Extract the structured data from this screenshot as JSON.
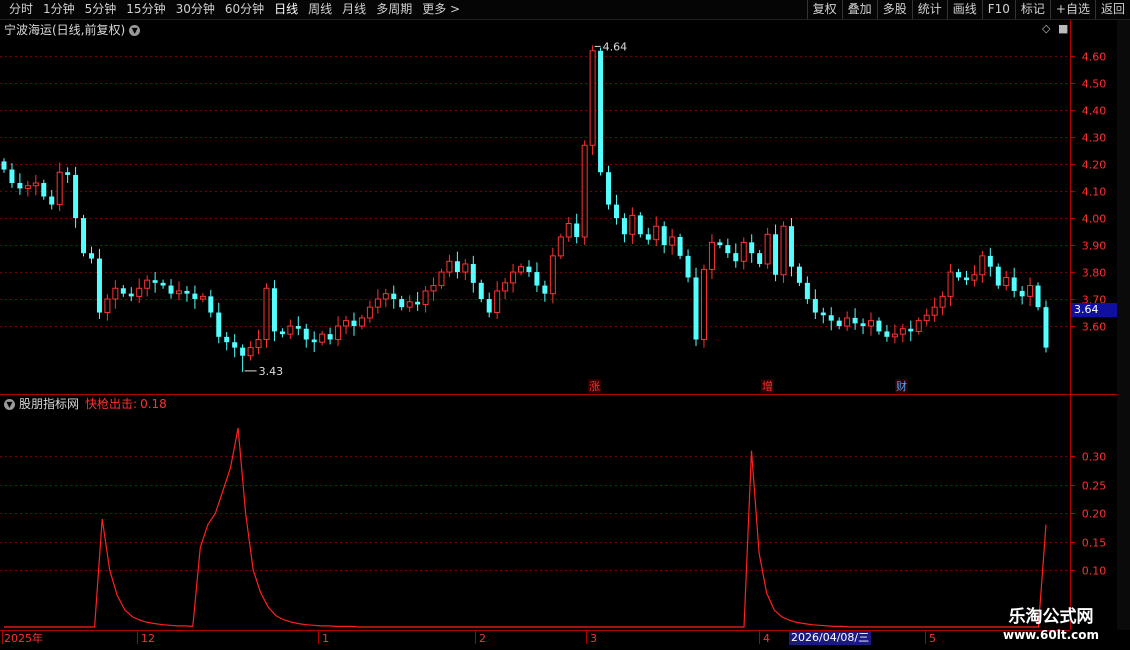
{
  "toolbar": {
    "periods": [
      "分时",
      "1分钟",
      "5分钟",
      "15分钟",
      "30分钟",
      "60分钟",
      "日线",
      "周线",
      "月线",
      "多周期",
      "更多 >"
    ],
    "active_period": "日线",
    "tools": [
      "复权",
      "叠加",
      "多股",
      "统计",
      "画线",
      "F10",
      "标记",
      "+自选",
      "返回"
    ]
  },
  "main_panel": {
    "title": "宁波海运(日线,前复权)",
    "high_label": "4.64",
    "low_label": "3.43",
    "current_price": "3.64",
    "events": [
      {
        "label": "涨",
        "color": "#ff3030"
      },
      {
        "label": "增",
        "color": "#ff3030"
      },
      {
        "label": "财",
        "color": "#4aa8ff"
      }
    ]
  },
  "indicator_panel": {
    "name": "股朋指标网",
    "line_label": "快枪出击:",
    "line_value": "0.18"
  },
  "date_axis": {
    "year_label": "2025年",
    "month_labels": [
      "12",
      "1",
      "2",
      "3",
      "4",
      "5"
    ],
    "cursor_date": "2026/04/08/三"
  },
  "watermark": {
    "title": "乐淘公式网",
    "url": "www.60lt.com"
  },
  "colors": {
    "up": "#ff3232",
    "down": "#54ffff",
    "indicator_line": "#ff2020",
    "grid": "#7a0000"
  },
  "chart_data": [
    {
      "type": "candlestick",
      "title": "宁波海运(日线,前复权)",
      "yticks": [
        3.6,
        3.7,
        3.8,
        3.9,
        4.0,
        4.1,
        4.2,
        4.3,
        4.4,
        4.5,
        4.6
      ],
      "ylim": [
        3.4,
        4.66
      ],
      "max": 4.64,
      "min": 3.43,
      "last": 3.64,
      "closes": [
        4.18,
        4.13,
        4.11,
        4.12,
        4.13,
        4.08,
        4.05,
        4.17,
        4.16,
        4.0,
        3.87,
        3.85,
        3.65,
        3.7,
        3.74,
        3.72,
        3.71,
        3.74,
        3.77,
        3.76,
        3.75,
        3.72,
        3.73,
        3.72,
        3.7,
        3.71,
        3.65,
        3.56,
        3.54,
        3.52,
        3.49,
        3.52,
        3.55,
        3.74,
        3.58,
        3.57,
        3.6,
        3.59,
        3.55,
        3.54,
        3.57,
        3.55,
        3.6,
        3.62,
        3.6,
        3.63,
        3.67,
        3.7,
        3.72,
        3.7,
        3.67,
        3.69,
        3.68,
        3.73,
        3.75,
        3.8,
        3.84,
        3.8,
        3.83,
        3.76,
        3.7,
        3.65,
        3.73,
        3.76,
        3.8,
        3.82,
        3.8,
        3.75,
        3.72,
        3.86,
        3.93,
        3.98,
        3.93,
        4.27,
        4.62,
        4.17,
        4.05,
        4.0,
        3.94,
        4.01,
        3.94,
        3.92,
        3.97,
        3.9,
        3.93,
        3.86,
        3.78,
        3.55,
        3.81,
        3.91,
        3.9,
        3.87,
        3.84,
        3.91,
        3.87,
        3.83,
        3.94,
        3.79,
        3.97,
        3.82,
        3.76,
        3.7,
        3.65,
        3.64,
        3.62,
        3.6,
        3.63,
        3.61,
        3.6,
        3.62,
        3.58,
        3.56,
        3.57,
        3.59,
        3.58,
        3.62,
        3.64,
        3.67,
        3.71,
        3.8,
        3.78,
        3.77,
        3.79,
        3.86,
        3.82,
        3.75,
        3.78,
        3.73,
        3.71,
        3.75,
        3.67,
        3.52
      ]
    },
    {
      "type": "line",
      "series": [
        {
          "name": "快枪出击",
          "last": 0.18
        }
      ],
      "yticks": [
        0.1,
        0.15,
        0.2,
        0.25,
        0.3
      ],
      "ylim": [
        0.0,
        0.385
      ],
      "values": [
        0.0,
        0.0,
        0.0,
        0.0,
        0.0,
        0.0,
        0.0,
        0.0,
        0.0,
        0.0,
        0.0,
        0.0,
        0.0,
        0.19,
        0.1,
        0.055,
        0.03,
        0.018,
        0.012,
        0.008,
        0.006,
        0.004,
        0.003,
        0.002,
        0.002,
        0.001,
        0.14,
        0.18,
        0.2,
        0.24,
        0.28,
        0.35,
        0.2,
        0.1,
        0.06,
        0.035,
        0.02,
        0.013,
        0.009,
        0.006,
        0.004,
        0.003,
        0.002,
        0.002,
        0.001,
        0.001,
        0.001,
        0.0,
        0.0,
        0.0,
        0.0,
        0.0,
        0.0,
        0.0,
        0.0,
        0.0,
        0.0,
        0.0,
        0.0,
        0.0,
        0.0,
        0.0,
        0.0,
        0.0,
        0.0,
        0.0,
        0.0,
        0.0,
        0.0,
        0.0,
        0.0,
        0.0,
        0.0,
        0.0,
        0.0,
        0.0,
        0.0,
        0.0,
        0.0,
        0.0,
        0.0,
        0.0,
        0.0,
        0.0,
        0.0,
        0.0,
        0.0,
        0.0,
        0.0,
        0.0,
        0.0,
        0.0,
        0.0,
        0.0,
        0.0,
        0.0,
        0.0,
        0.0,
        0.0,
        0.31,
        0.13,
        0.06,
        0.03,
        0.018,
        0.012,
        0.008,
        0.006,
        0.004,
        0.003,
        0.002,
        0.001,
        0.001,
        0.0,
        0.0,
        0.0,
        0.0,
        0.0,
        0.0,
        0.0,
        0.0,
        0.0,
        0.0,
        0.0,
        0.0,
        0.0,
        0.0,
        0.0,
        0.0,
        0.0,
        0.0,
        0.0,
        0.0,
        0.0,
        0.0,
        0.0,
        0.0,
        0.0,
        0.0,
        0.18
      ]
    }
  ]
}
